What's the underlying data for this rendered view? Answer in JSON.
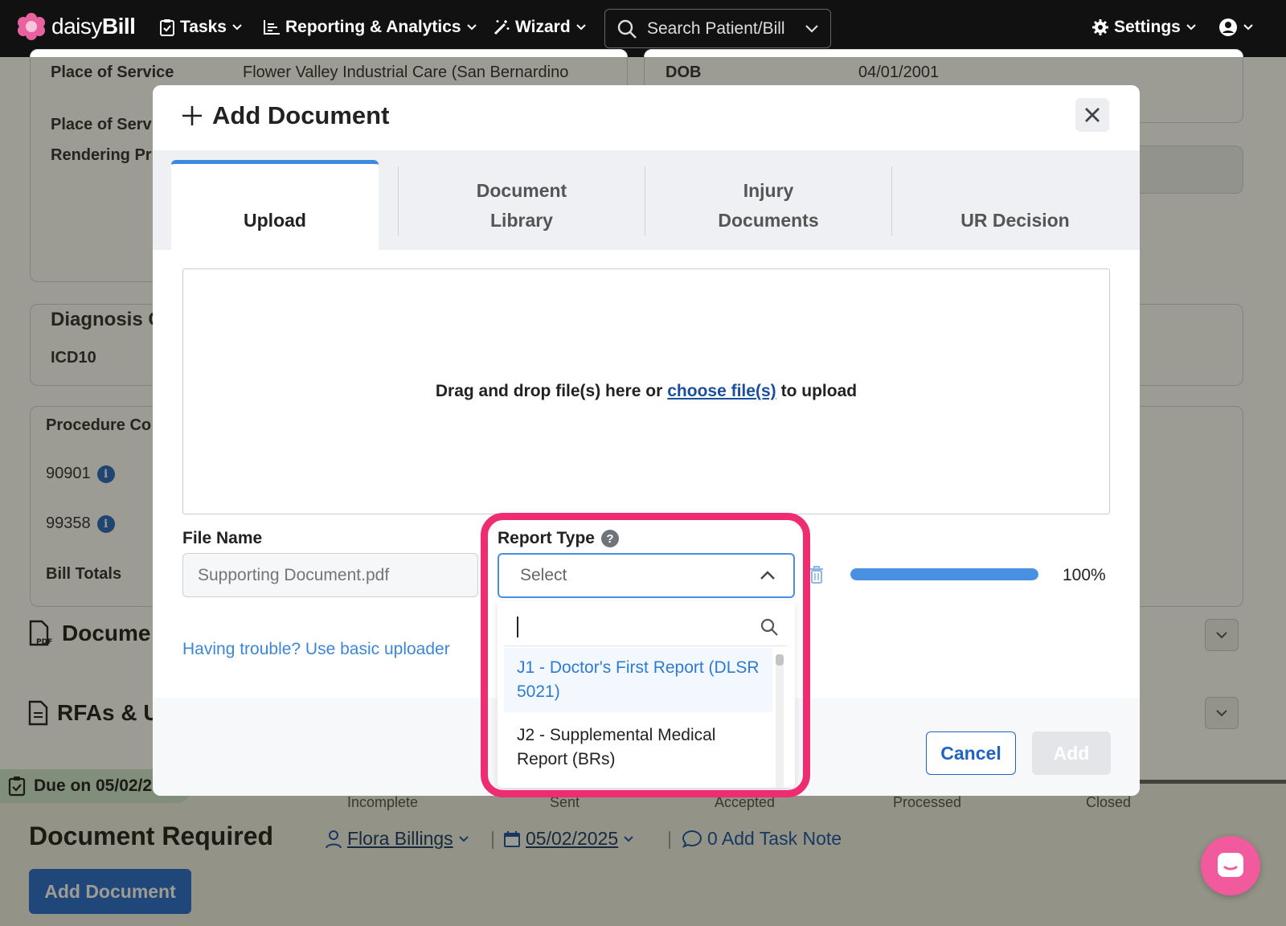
{
  "nav": {
    "brand_light": "daisy",
    "brand_bold": "Bill",
    "tasks": "Tasks",
    "reporting": "Reporting & Analytics",
    "wizard": "Wizard",
    "search_placeholder": "Search Patient/Bill",
    "settings": "Settings"
  },
  "background": {
    "place_of_service_label": "Place of Service",
    "place_of_service_value": "Flower Valley Industrial Care (San Bernardino",
    "dob_label": "DOB",
    "dob_value": "04/01/2001",
    "place_of_service_2_label": "Place of Servi",
    "rendering_label": "Rendering Pr",
    "diagnosis_header": "Diagnosis C",
    "icd_label": "ICD10",
    "procedure_header": "Procedure Co",
    "codes": [
      "90901",
      "99358"
    ],
    "bill_totals": "Bill Totals",
    "documents_header": "Docume",
    "rfas_header": "RFAs & U",
    "due_badge": "Due on 05/02/2",
    "steps": [
      "Incomplete",
      "Sent",
      "Accepted",
      "Processed",
      "Closed"
    ],
    "task_title": "Document Required",
    "assignee": "Flora Billings",
    "due_date": "05/02/2025",
    "notes": "0 Add Task Note",
    "add_document_button": "Add Document"
  },
  "modal": {
    "title": "Add Document",
    "tabs": [
      {
        "line1": "",
        "line2": "Upload"
      },
      {
        "line1": "Document",
        "line2": "Library"
      },
      {
        "line1": "Injury",
        "line2": "Documents"
      },
      {
        "line1": "",
        "line2": "UR Decision"
      }
    ],
    "drop_prefix": "Drag and drop file(s) here or",
    "drop_link": "choose file(s)",
    "drop_suffix": "to upload",
    "file_name_label": "File Name",
    "file_name_placeholder": "Supporting Document.pdf",
    "report_type_label": "Report Type",
    "report_type_help": "?",
    "select_placeholder": "Select",
    "progress_percent": 100,
    "progress_text": "100%",
    "trouble_link": "Having trouble? Use basic uploader",
    "cancel": "Cancel",
    "add": "Add",
    "dropdown_options": [
      {
        "line1": "J1 - Doctor's First Report (DLSR",
        "line2": "5021)",
        "highlighted": true
      },
      {
        "line1": "J2 - Supplemental Medical",
        "line2": "Report (BRs)",
        "highlighted": false
      }
    ]
  },
  "colors": {
    "accent": "#3c8ae0",
    "highlight_ring": "#ed2c72",
    "chat": "#f15b9d"
  }
}
